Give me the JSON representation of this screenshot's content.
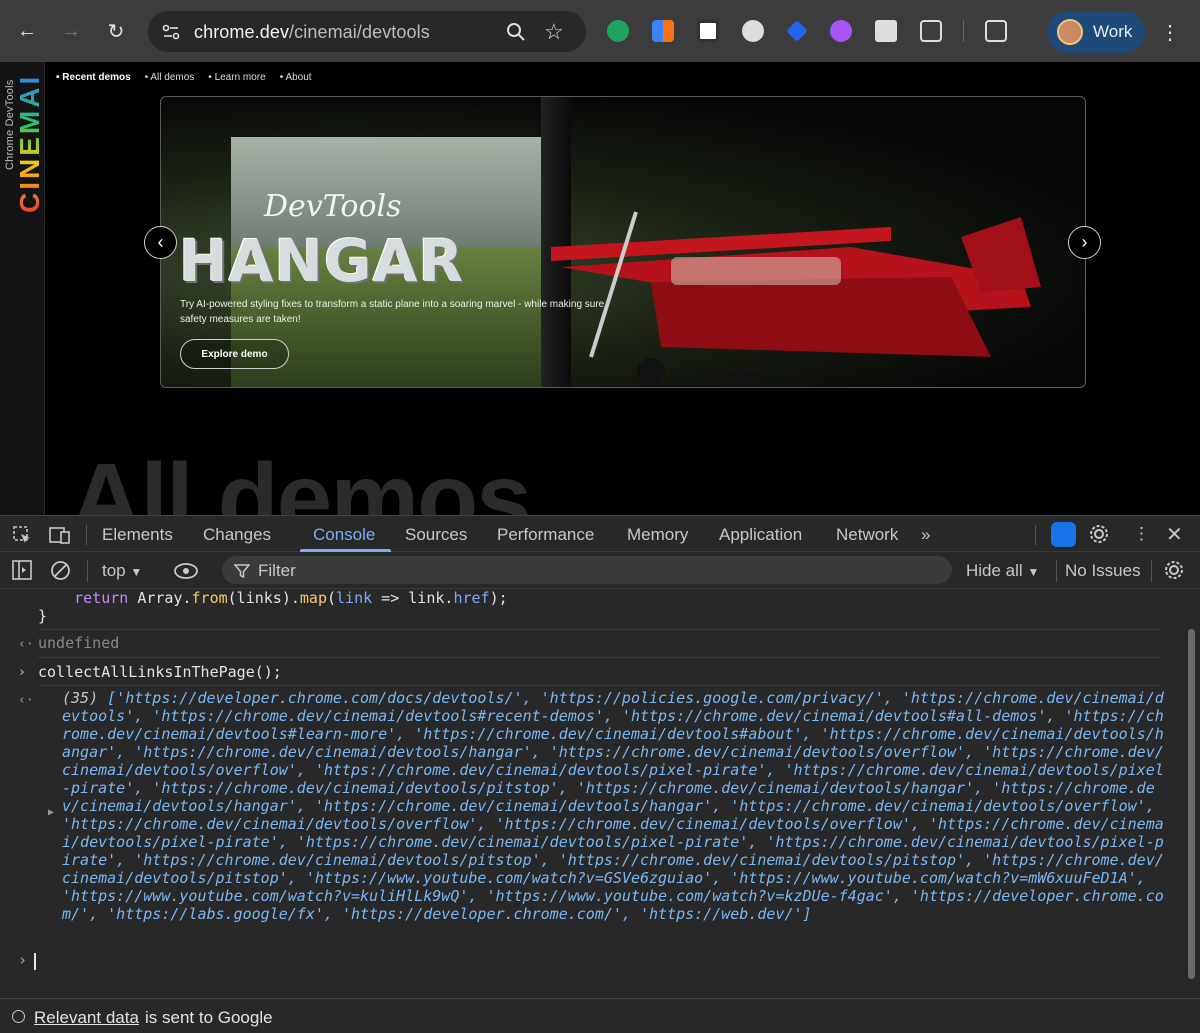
{
  "browser": {
    "url_host": "chrome.dev",
    "url_path": "/cinemai/devtools",
    "profile_label": "Work"
  },
  "page": {
    "rail_small": "Chrome DevTools",
    "rail_big": "CINEMAI",
    "nav": [
      "Recent demos",
      "All demos",
      "Learn more",
      "About"
    ],
    "hero": {
      "script_title": "DevTools",
      "title": "HANGAR",
      "description": "Try AI-powered styling fixes to transform a static plane into a soaring marvel - while making sure safety measures are taken!",
      "cta": "Explore demo"
    },
    "section_heading": "All demos"
  },
  "devtools": {
    "tabs": [
      "Elements",
      "Changes",
      "Console",
      "Sources",
      "Performance",
      "Memory",
      "Application",
      "Network"
    ],
    "active_tab": "Console",
    "context": "top",
    "filter_placeholder": "Filter",
    "levels": "Hide all",
    "issues": "No Issues",
    "console": {
      "line1": "    return Array.from(links).map(link => link.href);",
      "line2": "}",
      "undefined": "undefined",
      "command": "collectAllLinksInThePage();",
      "result_count": "(35)",
      "result_links": "['https://developer.chrome.com/docs/devtools/', 'https://policies.google.com/privacy/', 'https://chrome.dev/cinemai/devtools', 'https://chrome.dev/cinemai/devtools#recent-demos', 'https://chrome.dev/cinemai/devtools#all-demos', 'https://chrome.dev/cinemai/devtools#learn-more', 'https://chrome.dev/cinemai/devtools#about', 'https://chrome.dev/cinemai/devtools/hangar', 'https://chrome.dev/cinemai/devtools/hangar', 'https://chrome.dev/cinemai/devtools/overflow', 'https://chrome.dev/cinemai/devtools/overflow', 'https://chrome.dev/cinemai/devtools/pixel-pirate', 'https://chrome.dev/cinemai/devtools/pixel-pirate', 'https://chrome.dev/cinemai/devtools/pitstop', 'https://chrome.dev/cinemai/devtools/hangar', 'https://chrome.dev/cinemai/devtools/hangar', 'https://chrome.dev/cinemai/devtools/hangar', 'https://chrome.dev/cinemai/devtools/overflow', 'https://chrome.dev/cinemai/devtools/overflow', 'https://chrome.dev/cinemai/devtools/overflow', 'https://chrome.dev/cinemai/devtools/pixel-pirate', 'https://chrome.dev/cinemai/devtools/pixel-pirate', 'https://chrome.dev/cinemai/devtools/pixel-pirate', 'https://chrome.dev/cinemai/devtools/pitstop', 'https://chrome.dev/cinemai/devtools/pitstop', 'https://chrome.dev/cinemai/devtools/pitstop', 'https://www.youtube.com/watch?v=GSVe6zguiao', 'https://www.youtube.com/watch?v=mW6xuuFeD1A', 'https://www.youtube.com/watch?v=kuliHlLk9wQ', 'https://www.youtube.com/watch?v=kzDUe-f4gac', 'https://developer.chrome.com/', 'https://labs.google/fx', 'https://developer.chrome.com/', 'https://web.dev/']"
    },
    "footer_link": "Relevant data",
    "footer_text": "is sent to Google"
  },
  "colors": {
    "accent": "#7cacf8",
    "link_string": "#7ab8f5",
    "profile_bg": "#1e4a78"
  }
}
